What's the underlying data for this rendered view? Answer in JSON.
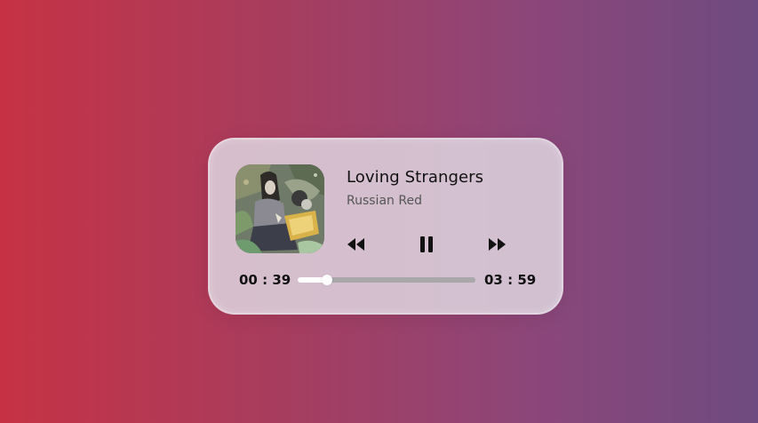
{
  "player": {
    "title": "Loving Strangers",
    "artist": "Russian Red",
    "current_time": "00 : 39",
    "total_time": "03 : 59",
    "progress": 0.163,
    "state": "playing",
    "cover_icon": "album-art",
    "controls": {
      "previous": "rewind-icon",
      "pause": "pause-icon",
      "next": "fast-forward-icon"
    }
  },
  "colors": {
    "background_start": "#c63244",
    "background_end": "#6e4b80",
    "card": "#ded6e0",
    "track": "#a9a7aa",
    "fill": "#ffffff",
    "text": "#111111",
    "subtext": "#555555"
  }
}
